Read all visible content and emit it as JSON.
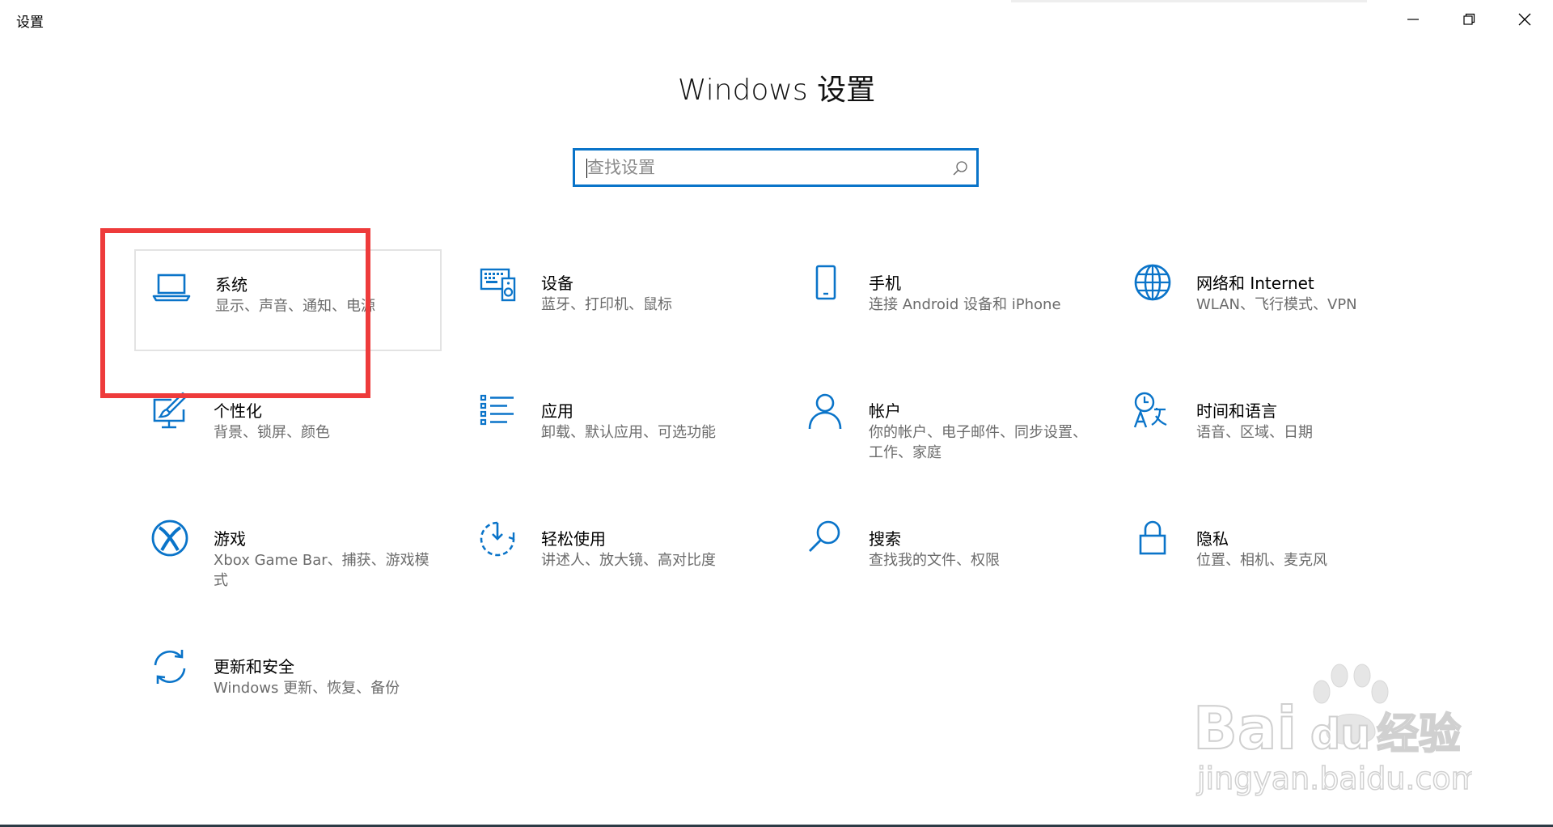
{
  "window": {
    "app_title": "设置",
    "controls": [
      "minimize-icon",
      "restore-icon",
      "close-icon"
    ]
  },
  "page": {
    "title": "Windows 设置"
  },
  "search": {
    "placeholder": "查找设置",
    "value": ""
  },
  "tiles": [
    {
      "icon": "laptop-icon",
      "name": "系统",
      "desc": "显示、声音、通知、电源"
    },
    {
      "icon": "devices-icon",
      "name": "设备",
      "desc": "蓝牙、打印机、鼠标"
    },
    {
      "icon": "phone-icon",
      "name": "手机",
      "desc": "连接 Android 设备和 iPhone"
    },
    {
      "icon": "globe-icon",
      "name": "网络和 Internet",
      "desc": "WLAN、飞行模式、VPN"
    },
    {
      "icon": "personalization-icon",
      "name": "个性化",
      "desc": "背景、锁屏、颜色"
    },
    {
      "icon": "apps-list-icon",
      "name": "应用",
      "desc": "卸载、默认应用、可选功能"
    },
    {
      "icon": "person-icon",
      "name": "帐户",
      "desc": "你的帐户、电子邮件、同步设置、工作、家庭"
    },
    {
      "icon": "time-language-icon",
      "name": "时间和语言",
      "desc": "语音、区域、日期"
    },
    {
      "icon": "xbox-icon",
      "name": "游戏",
      "desc": "Xbox Game Bar、捕获、游戏模式"
    },
    {
      "icon": "ease-of-access-icon",
      "name": "轻松使用",
      "desc": "讲述人、放大镜、高对比度"
    },
    {
      "icon": "search-icon",
      "name": "搜索",
      "desc": "查找我的文件、权限"
    },
    {
      "icon": "lock-icon",
      "name": "隐私",
      "desc": "位置、相机、麦克风"
    },
    {
      "icon": "update-icon",
      "name": "更新和安全",
      "desc": "Windows 更新、恢复、备份"
    }
  ],
  "watermark": {
    "brand": "Baidu经验",
    "url": "jingyan.baidu.com"
  },
  "colors": {
    "accent": "#0a74c9",
    "highlight": "#ee3b3b",
    "desc_text": "#6b6b6b"
  }
}
